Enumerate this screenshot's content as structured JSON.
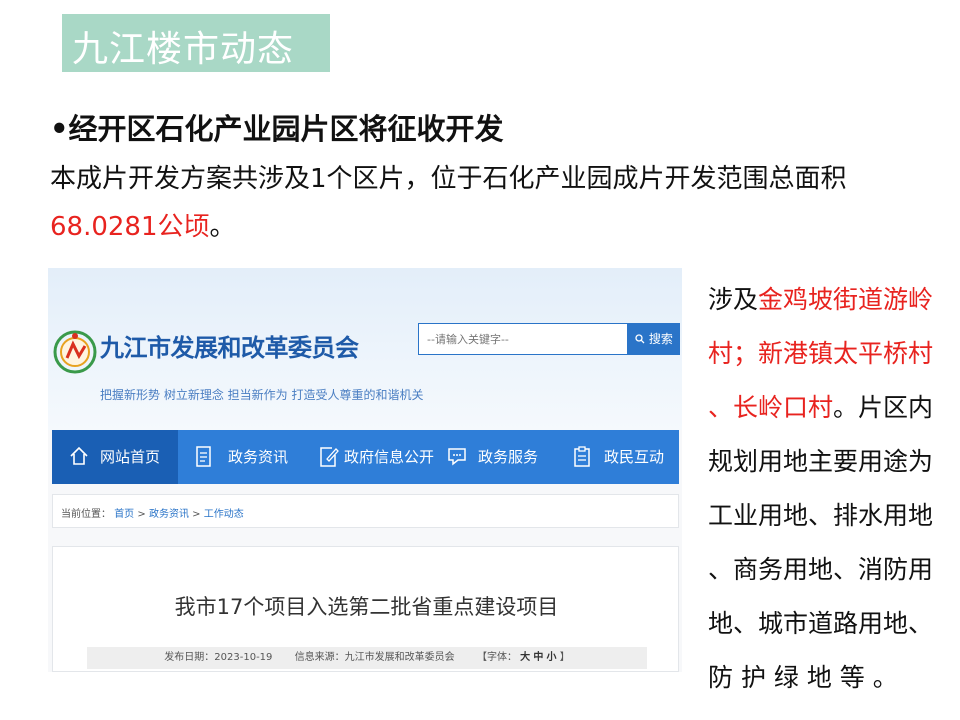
{
  "banner": {
    "title": "九江楼市动态"
  },
  "headline": "•经开区石化产业园片区将征收开发",
  "intro": {
    "line1": "本成片开发方案共涉及1个区片，位于石化产业园成片开发范围总面积",
    "area_value": "68.0281公顷",
    "line2_suffix": "。"
  },
  "screenshot": {
    "site_name": "九江市发展和改革委员会",
    "slogan": "把握新形势 树立新理念 担当新作为 打造受人尊重的和谐机关",
    "search": {
      "placeholder": "--请输入关键字--",
      "button": "搜索"
    },
    "nav": [
      "网站首页",
      "政务资讯",
      "政府信息公开",
      "政务服务",
      "政民互动"
    ],
    "breadcrumb": {
      "prefix": "当前位置：",
      "items": [
        "首页",
        "政务资讯",
        "工作动态"
      ],
      "separator": ">"
    },
    "article": {
      "title": "我市17个项目入选第二批省重点建设项目",
      "date": "发布日期：2023-10-19",
      "source": "信息来源：九江市发展和改革委员会",
      "font_label": "【字体：",
      "font_sizes": [
        "大",
        "中",
        "小"
      ],
      "font_close": "】"
    }
  },
  "side_text": {
    "l1_black": "涉及",
    "l1_red": "金鸡坡街道游岭",
    "l2_red": "村；新港镇太平桥村",
    "l3_red": "、长岭口村",
    "l3_black": "。片区内",
    "l4": "规划用地主要用途为",
    "l5": "工业用地、排水用地",
    "l6": "、商务用地、消防用",
    "l7": "地、城市道路用地、",
    "l8": "防 护 绿 地 等 。"
  },
  "colors": {
    "banner": "#a9d8c6",
    "highlight": "#e8231f",
    "nav": "#2f7ed8",
    "nav_active": "#1a5fb4"
  }
}
